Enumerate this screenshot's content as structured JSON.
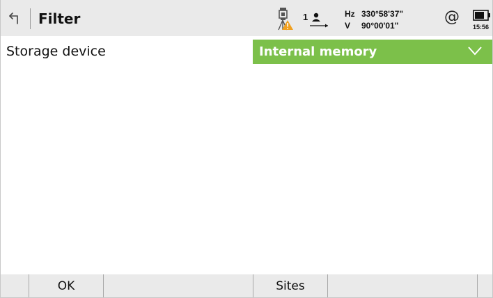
{
  "header": {
    "title": "Filter",
    "face_number": "1",
    "hz_label": "Hz",
    "hz_value": "330°58'37\"",
    "v_label": "V",
    "v_value": "90°00'01\"",
    "at_symbol": "@",
    "time": "15:56",
    "icons": {
      "back": "back-arrow-icon",
      "instrument": "instrument-warning-icon",
      "face": "face-person-icon",
      "connection": "at-icon",
      "battery": "battery-icon"
    }
  },
  "form": {
    "storage_label": "Storage device",
    "storage_value": "Internal memory"
  },
  "softkeys": {
    "ok": "OK",
    "sites": "Sites"
  },
  "colors": {
    "dropdown_bg": "#7cc04a",
    "warning": "#f0a020",
    "bars": "#eaeaea"
  }
}
